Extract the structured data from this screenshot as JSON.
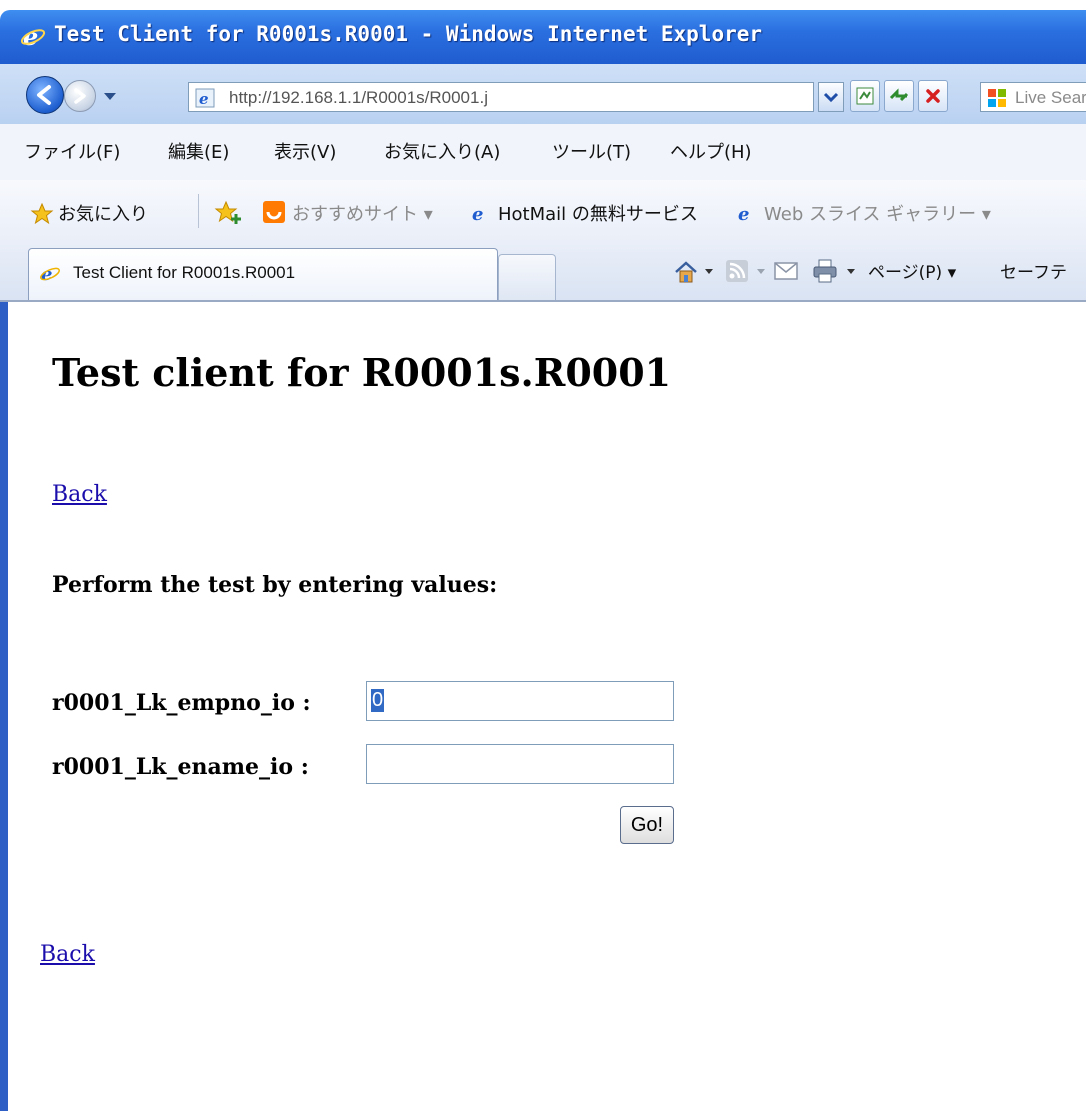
{
  "window": {
    "title": "Test Client for R0001s.R0001 - Windows Internet Explorer"
  },
  "navbar": {
    "url": "http://192.168.1.1/R0001s/R0001.j",
    "search_placeholder": "Live Search"
  },
  "menu": {
    "items": [
      "ファイル(F)",
      "編集(E)",
      "表示(V)",
      "お気に入り(A)",
      "ツール(T)",
      "ヘルプ(H)"
    ]
  },
  "favorites": {
    "label": "お気に入り",
    "items": [
      "おすすめサイト ▾",
      "HotMail の無料サービス",
      "Web スライス ギャラリー ▾"
    ]
  },
  "tabs": {
    "active": "Test Client for R0001s.R0001",
    "commands": [
      "ページ(P) ▾",
      "セーフテ"
    ]
  },
  "page": {
    "heading": "Test client for R0001s.R0001",
    "back_link": "Back",
    "instructions": "Perform the test by entering values:",
    "fields": [
      {
        "label": "r0001_Lk_empno_io :",
        "value": "0"
      },
      {
        "label": "r0001_Lk_ename_io :",
        "value": ""
      }
    ],
    "submit_label": "Go!"
  },
  "colors": {
    "titlebar": "#2a6fe0",
    "link": "#1a0dab",
    "selection": "#316ac5"
  }
}
